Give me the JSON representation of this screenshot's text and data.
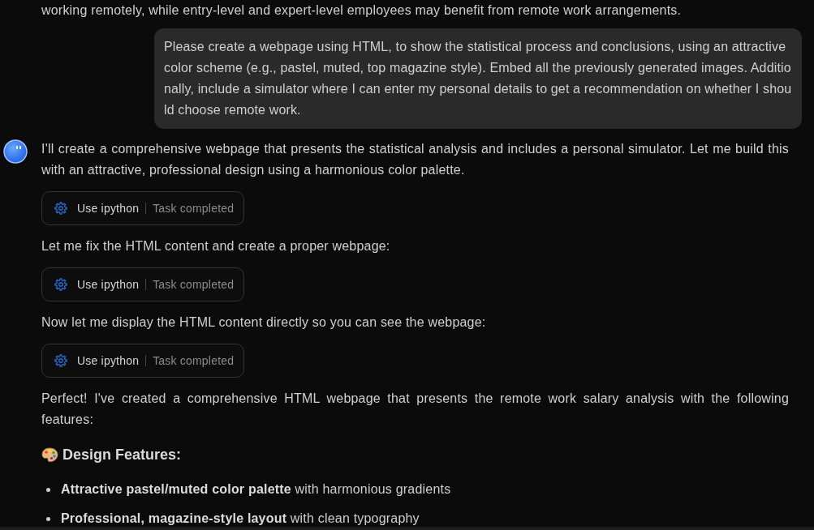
{
  "messages": [
    {
      "kind": "assistant",
      "blocks": [
        {
          "kind": "paragraph",
          "text": "working remotely, while entry-level and expert-level employees may benefit from remote work arrangements."
        }
      ]
    },
    {
      "kind": "user",
      "text": "Please create a webpage using HTML, to show the statistical process and conclusions, using an attractive color scheme (e.g., pastel, muted, top magazine style). Embed all the previously generated images. Additionally, include a simulator where I can enter my personal details to get a recommendation on whether I should choose remote work."
    },
    {
      "kind": "assistant",
      "avatar": true,
      "blocks": [
        {
          "kind": "paragraph",
          "text": "I'll create a comprehensive webpage that presents the statistical analysis and includes a personal simulator. Let me build this with an attractive, professional design using a harmonious color palette."
        },
        {
          "kind": "tool",
          "tool": "Use ipython",
          "status": "Task completed"
        },
        {
          "kind": "paragraph",
          "text": "Let me fix the HTML content and create a proper webpage:"
        },
        {
          "kind": "tool",
          "tool": "Use ipython",
          "status": "Task completed"
        },
        {
          "kind": "paragraph",
          "text": "Now let me display the HTML content directly so you can see the webpage:"
        },
        {
          "kind": "tool",
          "tool": "Use ipython",
          "status": "Task completed"
        },
        {
          "kind": "paragraph",
          "text": "Perfect! I've created a comprehensive HTML webpage that presents the remote work salary analysis with the following features:"
        },
        {
          "kind": "heading",
          "text": "Design Features:"
        },
        {
          "kind": "bullets",
          "items": [
            "**Attractive pastel/muted color palette** with harmonious gradients",
            "**Professional, magazine-style layout** with clean typography"
          ]
        }
      ]
    }
  ]
}
